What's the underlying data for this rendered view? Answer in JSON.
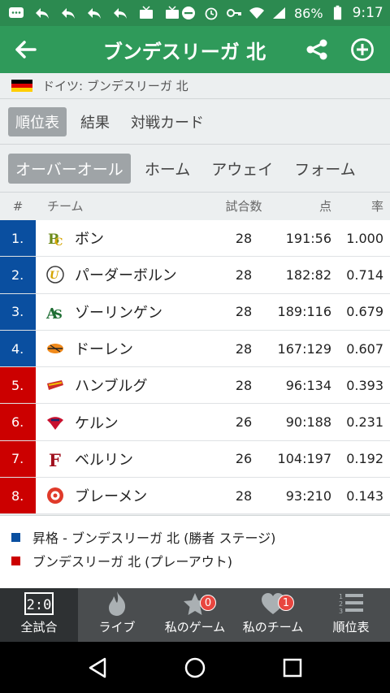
{
  "status": {
    "battery": "86%",
    "time": "9:17"
  },
  "appbar": {
    "title": "ブンデスリーガ 北"
  },
  "breadcrumb": {
    "text": "ドイツ: ブンデスリーガ 北"
  },
  "tabs_primary": [
    {
      "label": "順位表",
      "active": true
    },
    {
      "label": "結果",
      "active": false
    },
    {
      "label": "対戦カード",
      "active": false
    }
  ],
  "tabs_secondary": [
    {
      "label": "オーバーオール",
      "active": true
    },
    {
      "label": "ホーム",
      "active": false
    },
    {
      "label": "アウェイ",
      "active": false
    },
    {
      "label": "フォーム",
      "active": false
    }
  ],
  "table": {
    "headers": {
      "pos": "#",
      "team": "チーム",
      "gp": "試合数",
      "pts": "点",
      "pct": "率"
    },
    "rows": [
      {
        "pos": "1.",
        "team": "ボン",
        "gp": "28",
        "pts": "191:56",
        "pct": "1.000",
        "zone": "promotion"
      },
      {
        "pos": "2.",
        "team": "パーダーボルン",
        "gp": "28",
        "pts": "182:82",
        "pct": "0.714",
        "zone": "promotion"
      },
      {
        "pos": "3.",
        "team": "ゾーリンゲン",
        "gp": "28",
        "pts": "189:116",
        "pct": "0.679",
        "zone": "promotion"
      },
      {
        "pos": "4.",
        "team": "ドーレン",
        "gp": "28",
        "pts": "167:129",
        "pct": "0.607",
        "zone": "promotion"
      },
      {
        "pos": "5.",
        "team": "ハンブルグ",
        "gp": "28",
        "pts": "96:134",
        "pct": "0.393",
        "zone": "playout"
      },
      {
        "pos": "6.",
        "team": "ケルン",
        "gp": "26",
        "pts": "90:188",
        "pct": "0.231",
        "zone": "playout"
      },
      {
        "pos": "7.",
        "team": "ベルリン",
        "gp": "26",
        "pts": "104:197",
        "pct": "0.192",
        "zone": "playout"
      },
      {
        "pos": "8.",
        "team": "ブレーメン",
        "gp": "28",
        "pts": "93:210",
        "pct": "0.143",
        "zone": "playout"
      }
    ]
  },
  "legend": [
    {
      "color": "#0a4fa0",
      "text": "昇格 - ブンデスリーガ 北 (勝者 ステージ)"
    },
    {
      "color": "#cc0000",
      "text": "ブンデスリーガ 北 (プレーアウト)"
    }
  ],
  "colors": {
    "promotion": "#0a4fa0",
    "playout": "#cc0000",
    "appbar": "#2f9a5a",
    "statusbar": "#2c8a50"
  },
  "bottom_nav": [
    {
      "label": "全試合",
      "icon": "scoreboard-icon",
      "active": true,
      "badge": ""
    },
    {
      "label": "ライブ",
      "icon": "flame-icon",
      "active": false,
      "badge": ""
    },
    {
      "label": "私のゲーム",
      "icon": "star-icon",
      "active": false,
      "badge": "0"
    },
    {
      "label": "私のチーム",
      "icon": "heart-icon",
      "active": false,
      "badge": "1"
    },
    {
      "label": "順位表",
      "icon": "standings-list-icon",
      "active": false,
      "badge": ""
    }
  ],
  "bottom_nav_scoreboard_text": "2:0"
}
